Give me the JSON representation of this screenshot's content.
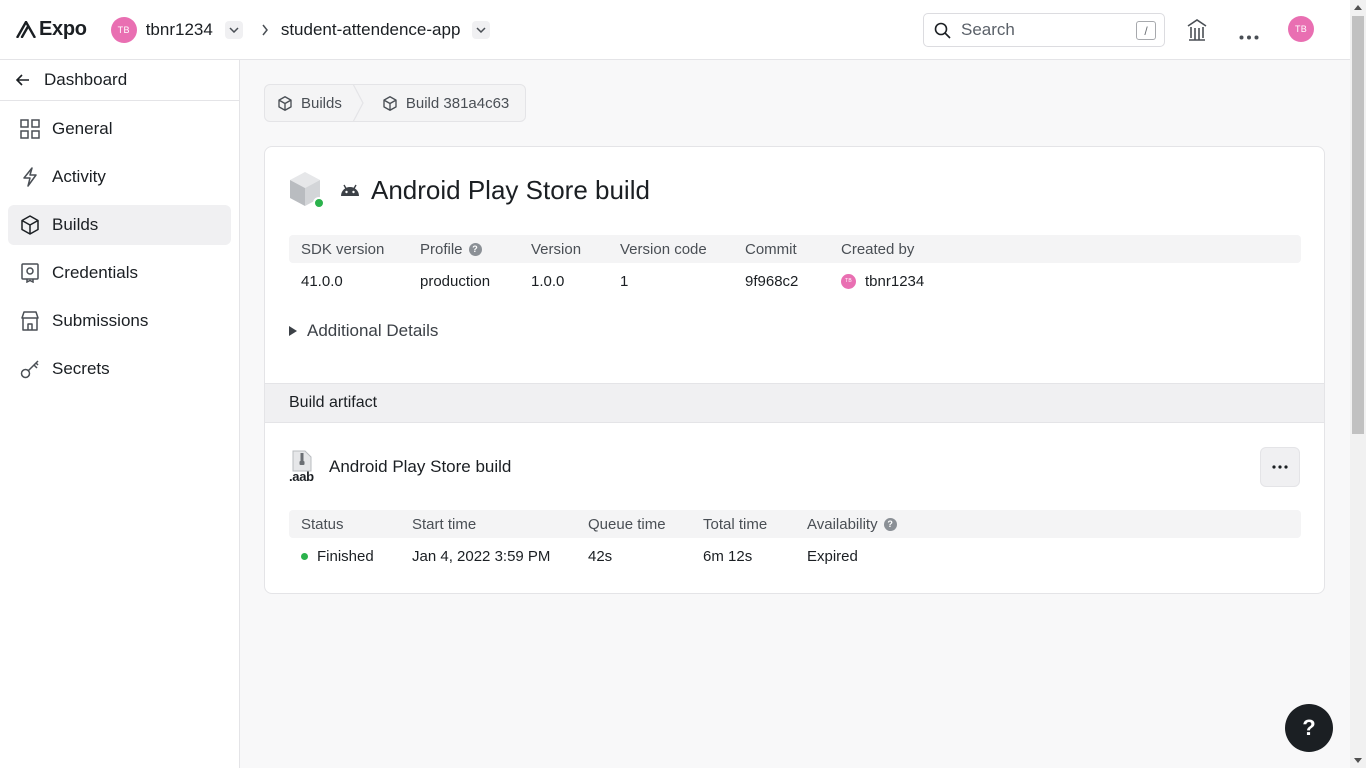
{
  "header": {
    "brand": "Expo",
    "account_avatar": "TB",
    "account_name": "tbnr1234",
    "project_name": "student-attendence-app",
    "search_placeholder": "Search",
    "search_shortcut": "/",
    "user_avatar": "TB"
  },
  "sidebar": {
    "back_label": "Dashboard",
    "items": [
      {
        "label": "General",
        "icon": "grid-icon"
      },
      {
        "label": "Activity",
        "icon": "bolt-icon"
      },
      {
        "label": "Builds",
        "icon": "cube-icon",
        "active": true
      },
      {
        "label": "Credentials",
        "icon": "credentials-icon"
      },
      {
        "label": "Submissions",
        "icon": "store-icon"
      },
      {
        "label": "Secrets",
        "icon": "key-icon"
      }
    ]
  },
  "breadcrumb": {
    "items": [
      "Builds",
      "Build 381a4c63"
    ]
  },
  "build": {
    "title": "Android Play Store build",
    "status_color": "#2bb24c",
    "meta_headers": [
      "SDK version",
      "Profile",
      "Version",
      "Version code",
      "Commit",
      "Created by"
    ],
    "meta_values": [
      "41.0.0",
      "production",
      "1.0.0",
      "1",
      "9f968c2",
      "tbnr1234"
    ],
    "creator_avatar": "TB",
    "details_label": "Additional Details"
  },
  "artifact": {
    "section_title": "Build artifact",
    "file_ext": ".aab",
    "name": "Android Play Store build",
    "headers": [
      "Status",
      "Start time",
      "Queue time",
      "Total time",
      "Availability"
    ],
    "values": [
      "Finished",
      "Jan 4, 2022 3:59 PM",
      "42s",
      "6m 12s",
      "Expired"
    ]
  },
  "help_button": "?"
}
